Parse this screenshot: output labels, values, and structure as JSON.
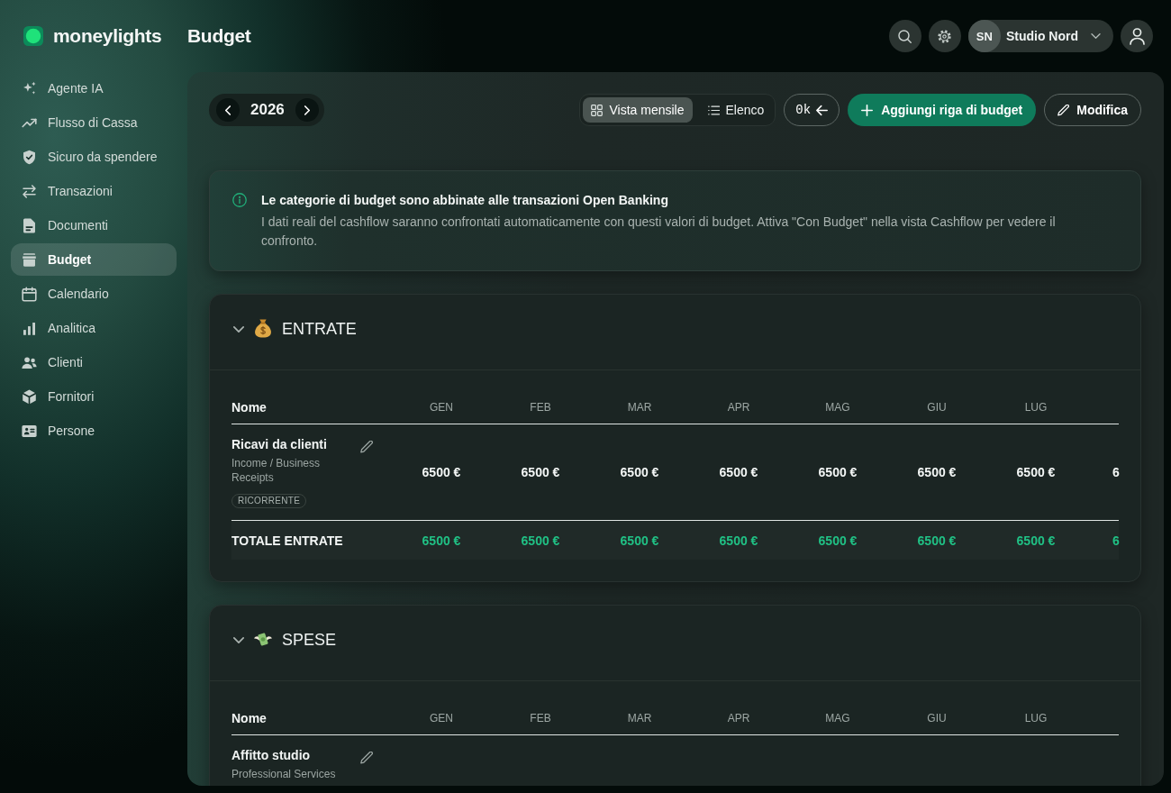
{
  "app": {
    "name": "moneylights"
  },
  "sidebar": {
    "items": [
      {
        "label": "Agente IA",
        "selected": false
      },
      {
        "label": "Flusso di Cassa",
        "selected": false
      },
      {
        "label": "Sicuro da spendere",
        "selected": false
      },
      {
        "label": "Transazioni",
        "selected": false
      },
      {
        "label": "Documenti",
        "selected": false
      },
      {
        "label": "Budget",
        "selected": true
      },
      {
        "label": "Calendario",
        "selected": false
      },
      {
        "label": "Analitica",
        "selected": false
      },
      {
        "label": "Clienti",
        "selected": false
      },
      {
        "label": "Fornitori",
        "selected": false
      },
      {
        "label": "Persone",
        "selected": false
      }
    ]
  },
  "header": {
    "title": "Budget",
    "account": {
      "initials": "SN",
      "name": "Studio Nord"
    }
  },
  "toolbar": {
    "year": "2026",
    "views": [
      {
        "label": "Vista mensile",
        "selected": true
      },
      {
        "label": "Elenco",
        "selected": false
      }
    ],
    "units_button": "0k",
    "add_button": "Aggiungi riga di budget",
    "edit_button": "Modifica"
  },
  "notice": {
    "title": "Le categorie di budget sono abbinate alle transazioni Open Banking",
    "text": "I dati reali del cashflow saranno confrontati automaticamente con questi valori di budget. Attiva \"Con Budget\" nella vista Cashflow per vedere il confronto."
  },
  "sections": [
    {
      "title": "ENTRATE",
      "expanded": true,
      "columns": [
        "Nome",
        "GEN",
        "FEB",
        "MAR",
        "APR",
        "MAG",
        "GIU",
        "LUG"
      ],
      "rows": [
        {
          "name": "Ricavi da clienti",
          "category": "Income / Business Receipts",
          "tag": "RICORRENTE",
          "values": [
            "6500 €",
            "6500 €",
            "6500 €",
            "6500 €",
            "6500 €",
            "6500 €",
            "6500 €",
            "6"
          ]
        }
      ],
      "total": {
        "label": "TOTALE ENTRATE",
        "values": [
          "6500 €",
          "6500 €",
          "6500 €",
          "6500 €",
          "6500 €",
          "6500 €",
          "6500 €",
          "6"
        ]
      }
    },
    {
      "title": "SPESE",
      "expanded": true,
      "columns": [
        "Nome",
        "GEN",
        "FEB",
        "MAR",
        "APR",
        "MAG",
        "GIU",
        "LUG"
      ],
      "rows": [
        {
          "name": "Affitto studio",
          "category": "Professional Services"
        }
      ]
    }
  ]
}
